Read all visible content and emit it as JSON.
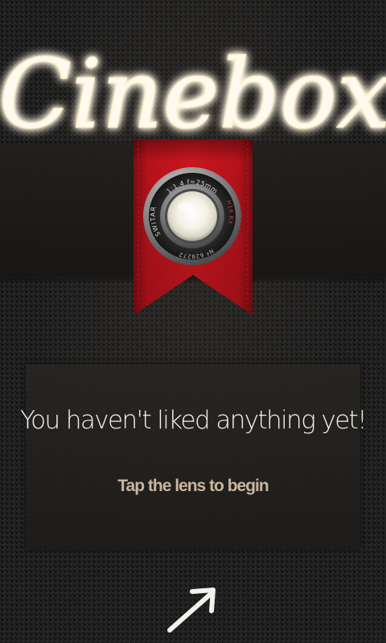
{
  "app": {
    "logo_text": "Cinebox"
  },
  "lens": {
    "engraving_top": "1:1.4   f=25mm",
    "engraving_left": "SWITAR",
    "engraving_right": "H16 RX",
    "engraving_bottom": "Nº 628272"
  },
  "empty_state": {
    "message": "You haven't liked anything yet!",
    "hint": "Tap the lens to begin"
  },
  "colors": {
    "ribbon": "#b5121b",
    "hint": "#c9b79c",
    "logo_glow": "#fff4d6"
  },
  "icons": {
    "arrow": "arrow-up-right-icon"
  }
}
